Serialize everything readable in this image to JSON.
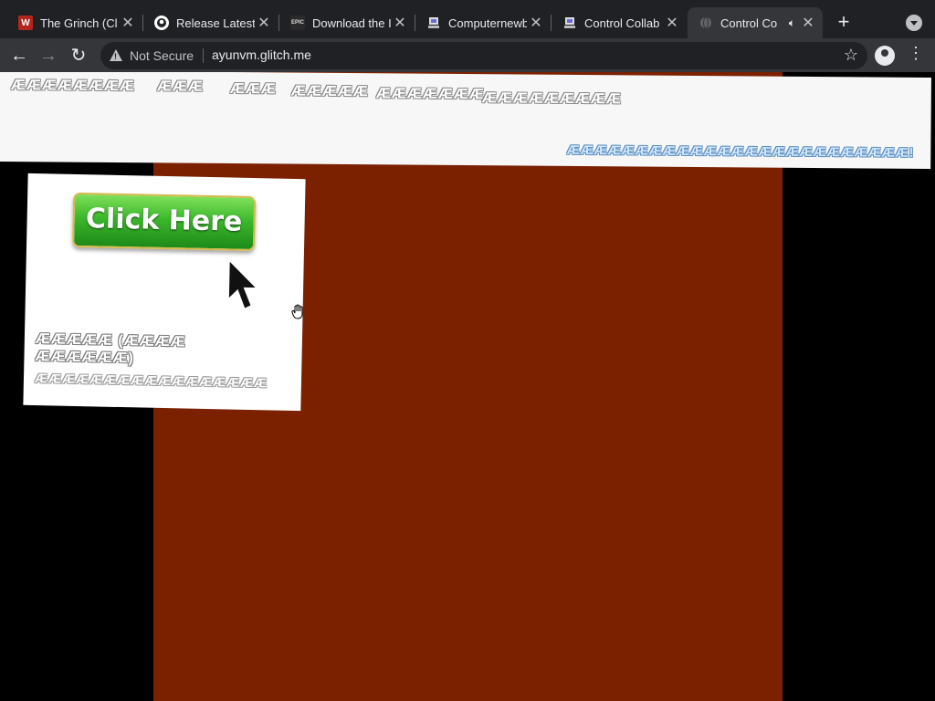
{
  "browser": {
    "tabs": [
      {
        "title": "The Grinch (Cl",
        "favicon": "W",
        "favicon_color": "#b3261e",
        "active": false
      },
      {
        "title": "Release Latest",
        "favicon": "github-icon",
        "active": false
      },
      {
        "title": "Download the I",
        "favicon": "EPIC",
        "active": false
      },
      {
        "title": "Computernewb",
        "favicon": "computernewb-icon",
        "active": false
      },
      {
        "title": "Control Collab",
        "favicon": "computernewb-icon",
        "active": false
      },
      {
        "title": "Control Co",
        "favicon": "globe-icon",
        "active": true,
        "audio": true
      }
    ],
    "new_tab": "+",
    "address": {
      "security": "Not Secure",
      "url": "ayunvm.glitch.me"
    }
  },
  "page": {
    "nav_links": [
      "ÆÆÆÆÆÆÆÆ",
      "ÆÆÆ",
      "ÆÆÆ",
      "ÆÆÆÆÆ",
      "ÆÆÆÆÆÆÆ",
      "ÆÆÆÆÆÆÆÆÆ"
    ],
    "banner_text": "ÆÆÆÆÆÆÆÆÆÆÆÆÆÆÆÆÆÆÆÆÆÆÆÆÆ!",
    "card": {
      "button_label": "Click Here",
      "text_line1": "ÆÆÆÆÆ (ÆÆÆÆ ÆÆÆÆÆÆ)",
      "text_line2": "ÆÆÆÆÆÆÆÆÆÆÆÆÆÆÆÆÆ"
    }
  },
  "colors": {
    "page_background": "#000000",
    "center_panel": "#7b2100",
    "button_green": "#3cb82c"
  }
}
